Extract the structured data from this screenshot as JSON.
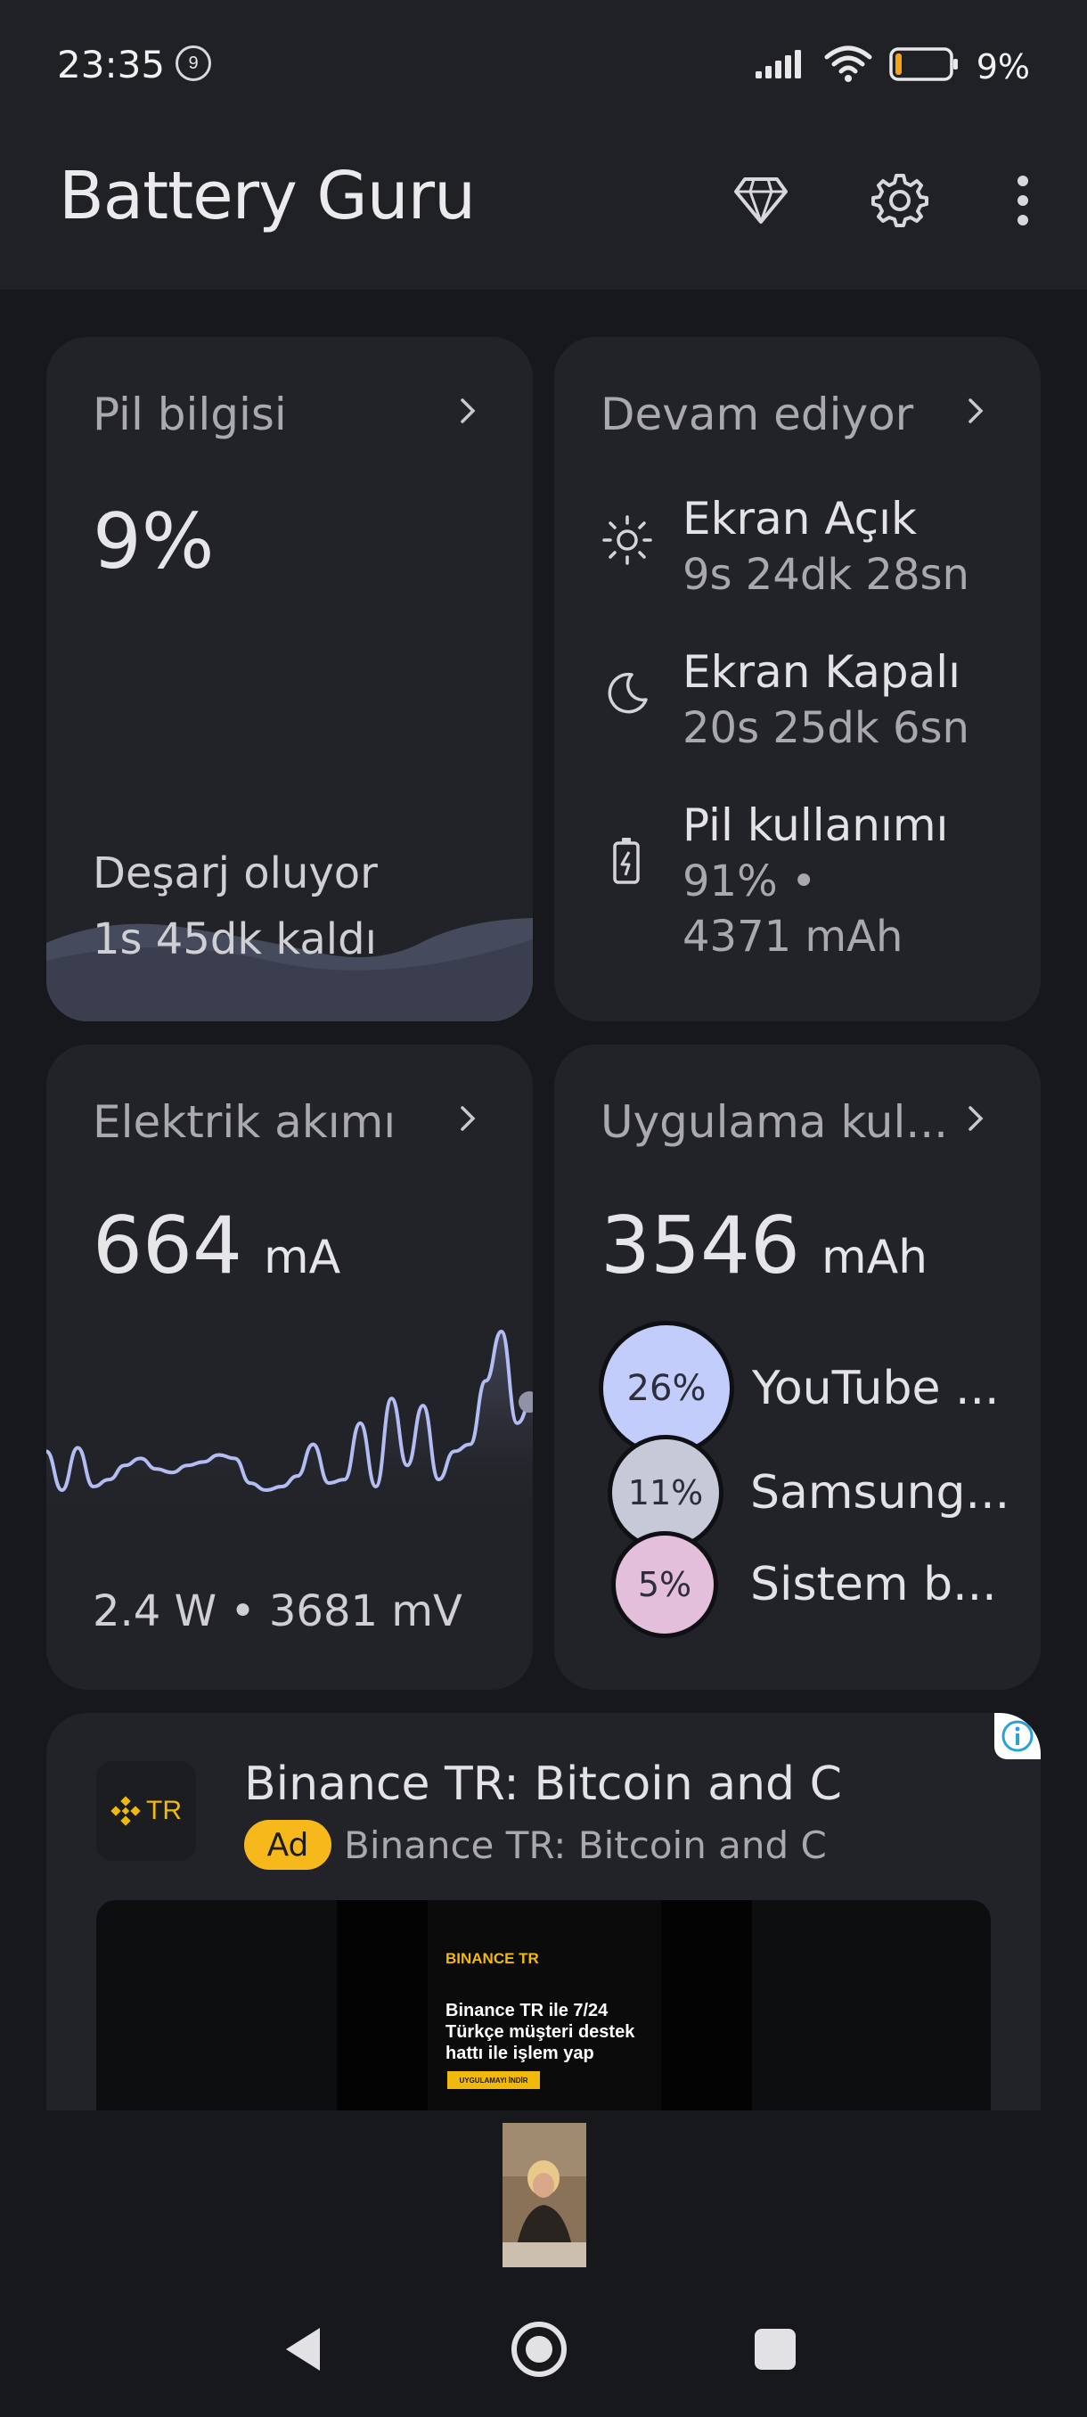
{
  "status_bar": {
    "time": "23:35",
    "notification_count": "9",
    "battery_percent": "9%",
    "icons": [
      "signal-icon",
      "wifi-icon",
      "battery-icon"
    ]
  },
  "app_bar": {
    "title": "Battery Guru",
    "icons": [
      "premium-diamond-icon",
      "settings-gear-icon",
      "overflow-menu-icon"
    ]
  },
  "battery_info": {
    "title": "Pil bilgisi",
    "percent": "9%",
    "status": "Deşarj oluyor",
    "remaining": "1s 45dk kaldı",
    "level": 0.09
  },
  "ongoing": {
    "title": "Devam ediyor",
    "screen_on_label": "Ekran Açık",
    "screen_on_value": "9s 24dk 28sn",
    "screen_off_label": "Ekran Kapalı",
    "screen_off_value": "20s 25dk 6sn",
    "usage_label": "Pil kullanımı",
    "usage_percent": "91% •",
    "usage_mah": "4371 mAh"
  },
  "current": {
    "title": "Elektrik akımı",
    "value": "664",
    "unit": "mA",
    "footer": "2.4 W • 3681 mV",
    "samples": [
      30,
      8,
      32,
      10,
      14,
      22,
      26,
      20,
      18,
      22,
      24,
      28,
      26,
      12,
      8,
      10,
      16,
      34,
      12,
      14,
      46,
      10,
      60,
      22,
      56,
      14,
      30,
      34,
      70,
      98,
      46,
      60
    ]
  },
  "app_usage": {
    "title": "Uygulama kul...",
    "value": "3546",
    "unit": "mAh",
    "apps": [
      {
        "name": "YouTube ...",
        "percent": "26%",
        "color": "#c3cdfb"
      },
      {
        "name": "Samsung...",
        "percent": "11%",
        "color": "#c6cad8"
      },
      {
        "name": "Sistem b...",
        "percent": "5%",
        "color": "#e3bfdc"
      }
    ]
  },
  "ad": {
    "logo_text": "TR",
    "title": "Binance TR: Bitcoin and C",
    "badge": "Ad",
    "subtitle": "Binance TR: Bitcoin and C",
    "creative_brand": "BINANCE TR",
    "creative_text": "Binance TR ile 7/24 Türkçe müşteri destek hattı ile işlem yap",
    "creative_button": "UYGULAMAYI İNDİR"
  },
  "nav": {
    "buttons": [
      "back-icon",
      "home-icon",
      "recents-icon"
    ]
  }
}
